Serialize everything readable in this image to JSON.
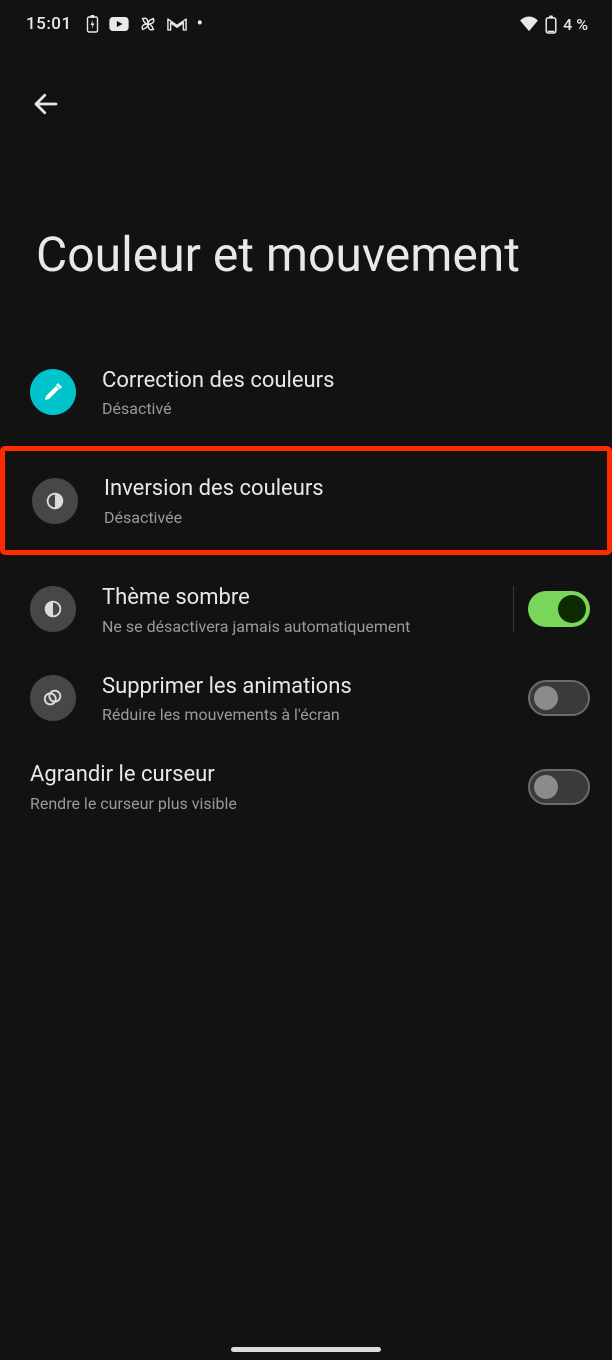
{
  "status": {
    "time": "15:01",
    "battery_text": "4 %"
  },
  "page": {
    "title": "Couleur et mouvement"
  },
  "items": {
    "color_correction": {
      "title": "Correction des couleurs",
      "sub": "Désactivé"
    },
    "color_inversion": {
      "title": "Inversion des couleurs",
      "sub": "Désactivée"
    },
    "dark_theme": {
      "title": "Thème sombre",
      "sub": "Ne se désactivera jamais automatiquement"
    },
    "remove_anim": {
      "title": "Supprimer les animations",
      "sub": "Réduire les mouvements à l'écran"
    },
    "large_cursor": {
      "title": "Agrandir le curseur",
      "sub": "Rendre le curseur plus visible"
    }
  }
}
